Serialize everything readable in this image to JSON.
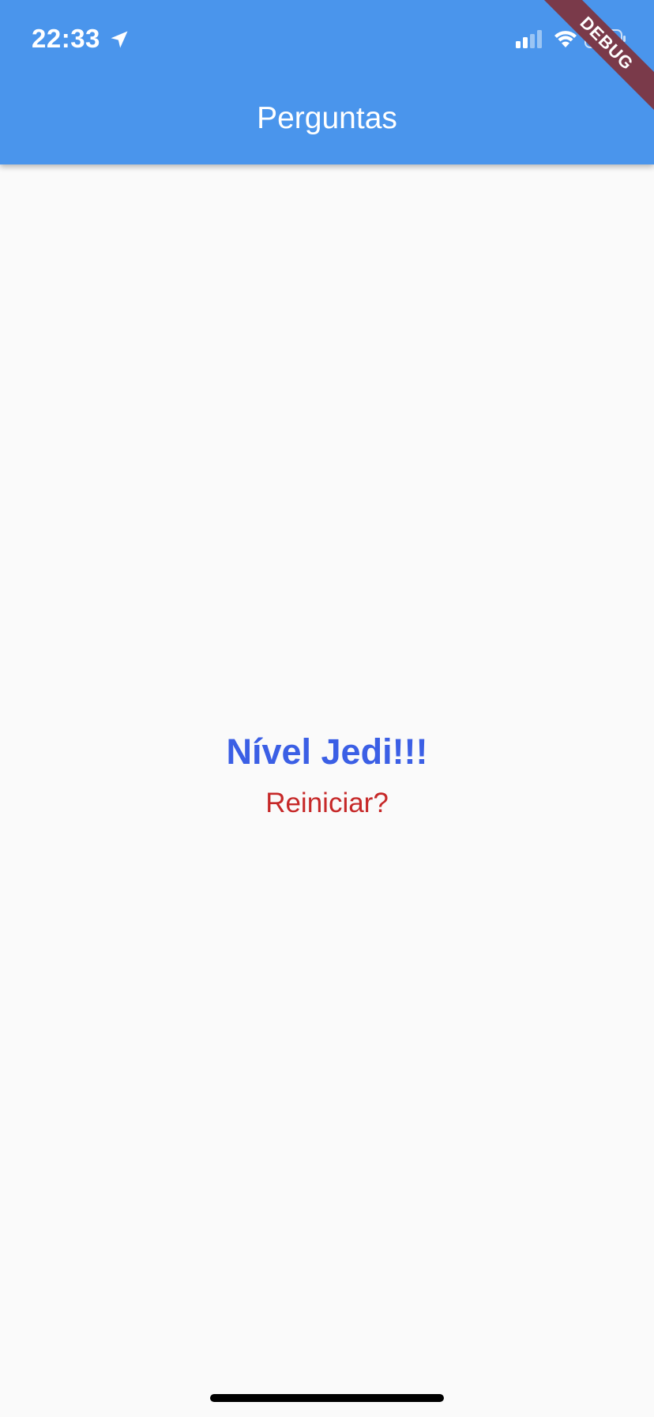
{
  "status_bar": {
    "time": "22:33",
    "icons": [
      "location-arrow-icon",
      "cellular-signal-icon",
      "wifi-icon",
      "battery-charging-icon"
    ]
  },
  "app_bar": {
    "title": "Perguntas",
    "color": "#4a95ec"
  },
  "debug_banner": {
    "label": "DEBUG"
  },
  "result": {
    "message": "Nível Jedi!!!",
    "message_color": "#3b5fe5",
    "restart_label": "Reiniciar?",
    "restart_color": "#c62828"
  }
}
